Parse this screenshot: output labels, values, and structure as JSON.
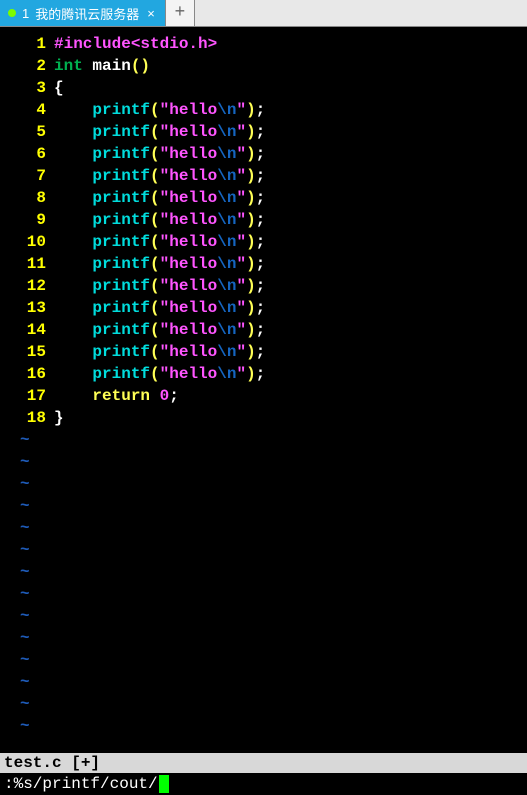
{
  "tab": {
    "index": "1",
    "title": "我的腾讯云服务器",
    "close_glyph": "×",
    "new_glyph": "+"
  },
  "code": {
    "include_kw": "#include",
    "include_file": "<stdio.h>",
    "int_kw": "int",
    "main_id": "main",
    "open_paren": "(",
    "close_paren": ")",
    "open_brace": "{",
    "close_brace": "}",
    "printf_id": "printf",
    "str_open": "\"",
    "str_text": "hello",
    "str_esc": "\\n",
    "str_close": "\"",
    "semicolon": ";",
    "return_kw": "return",
    "zero": "0",
    "line_numbers": [
      "1",
      "2",
      "3",
      "4",
      "5",
      "6",
      "7",
      "8",
      "9",
      "10",
      "11",
      "12",
      "13",
      "14",
      "15",
      "16",
      "17",
      "18"
    ],
    "tilde": "~",
    "tilde_count": 14
  },
  "status": {
    "text": "test.c [+]"
  },
  "command": {
    "text": ":%s/printf/cout/"
  }
}
